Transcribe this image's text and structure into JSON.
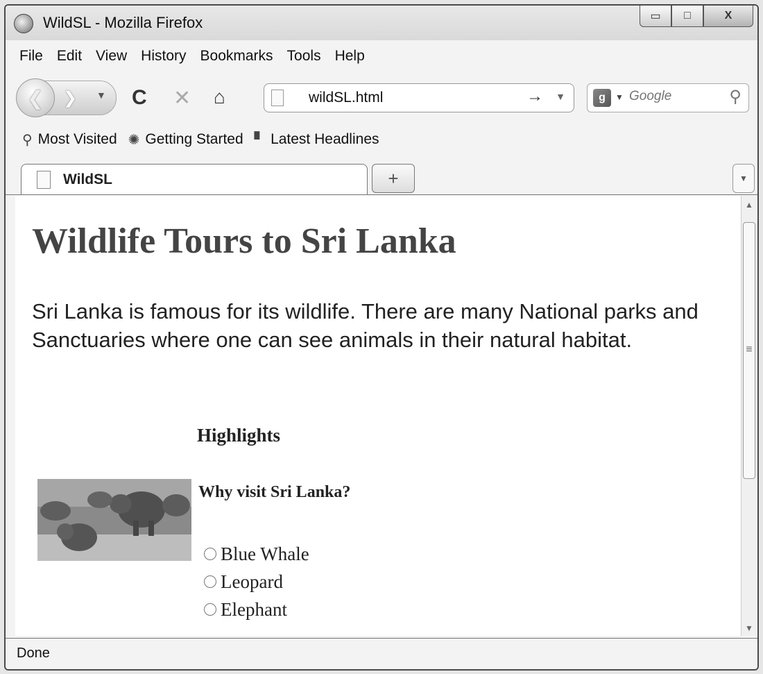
{
  "window": {
    "title": "WildSL - Mozilla Firefox",
    "controls": {
      "minimize": "▭",
      "maximize": "□",
      "close": "X"
    }
  },
  "menu": [
    {
      "label": "File"
    },
    {
      "label": "Edit"
    },
    {
      "label": "View"
    },
    {
      "label": "History"
    },
    {
      "label": "Bookmarks"
    },
    {
      "label": "Tools"
    },
    {
      "label": "Help"
    }
  ],
  "navigation": {
    "url": "wildSL.html",
    "search_placeholder": "Google",
    "icons": [
      "back-icon",
      "forward-icon",
      "reload-icon",
      "stop-icon",
      "home-icon",
      "go-arrow-icon",
      "search-icon"
    ]
  },
  "bookmarks": [
    {
      "label": "Most Visited",
      "icon": "most-visited-icon"
    },
    {
      "label": "Getting Started",
      "icon": "firefox-icon"
    },
    {
      "label": "Latest Headlines",
      "icon": "rss-icon"
    }
  ],
  "tabs": [
    {
      "label": "WildSL",
      "active": true
    }
  ],
  "page": {
    "title": "Wildlife Tours to Sri Lanka",
    "intro": "Sri Lanka is famous for its wildlife. There are many National parks and Sanctuaries where one can see animals in their natural habitat.",
    "highlights_heading": "Highlights",
    "question": "Why visit Sri Lanka?",
    "options": [
      {
        "label": "Blue Whale"
      },
      {
        "label": "Leopard"
      },
      {
        "label": "Elephant"
      }
    ]
  },
  "status": {
    "text": "Done"
  }
}
